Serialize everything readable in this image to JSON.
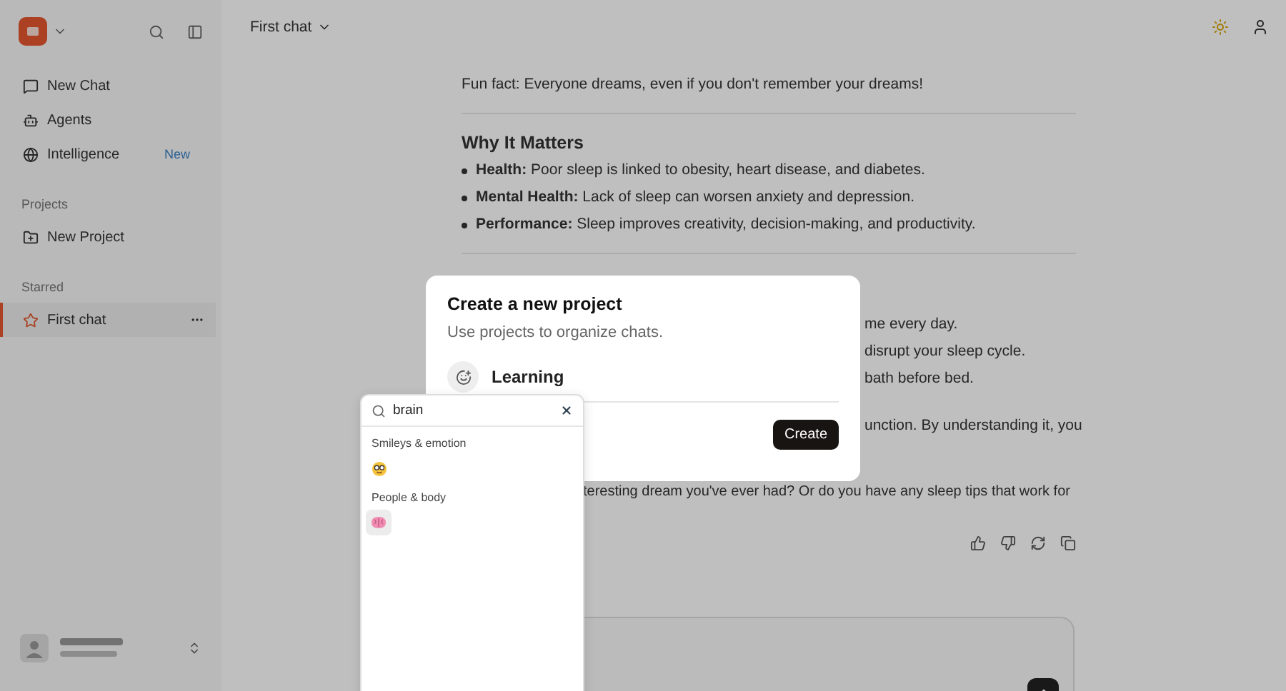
{
  "sidebar": {
    "nav": [
      {
        "label": "New Chat"
      },
      {
        "label": "Agents"
      },
      {
        "label": "Intelligence",
        "badge": "New"
      }
    ],
    "sections": [
      {
        "title": "Projects",
        "items": [
          {
            "label": "New Project",
            "selected": false
          }
        ]
      },
      {
        "title": "Starred",
        "items": [
          {
            "label": "First chat",
            "selected": true
          }
        ]
      }
    ]
  },
  "header": {
    "chat_title": "First chat"
  },
  "message": {
    "fun_fact": "Fun fact: Everyone dreams, even if you don't remember your dreams!",
    "heading": "Why It Matters",
    "bullets": [
      "**Health:** Poor sleep is linked to obesity, heart disease, and diabetes.",
      "**Mental Health:** Lack of sleep can worsen anxiety and depression.",
      "**Performance:** Sleep improves creativity, decision-making, and productivity."
    ],
    "covered_lines": [
      "me every day.",
      "disrupt your sleep cycle.",
      "bath before bed."
    ],
    "paragraph_fragment": "unction. By understanding it, you",
    "closing_fragment": "teresting dream you've ever had? Or do you have any sleep tips that work for"
  },
  "dialog": {
    "title": "Create a new project",
    "subtitle": "Use projects to organize chats.",
    "name_value": "Learning",
    "button": "Create"
  },
  "emoji_picker": {
    "query": "brain",
    "groups": [
      {
        "title": "Smileys & emotion",
        "items": [
          {
            "kind": "nerd",
            "selected": false
          }
        ]
      },
      {
        "title": "People & body",
        "items": [
          {
            "kind": "brain",
            "selected": true
          }
        ]
      }
    ]
  }
}
